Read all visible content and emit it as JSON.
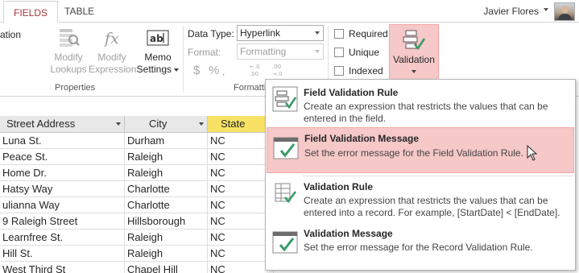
{
  "tabs": {
    "fields": "FIELDS",
    "table": "TABLE"
  },
  "user": {
    "name": "Javier Flores"
  },
  "ribbon": {
    "partial_label": "ation",
    "modify_lookups": [
      "Modify",
      "Lookups"
    ],
    "modify_expression": [
      "Modify",
      "Expression"
    ],
    "memo_settings": [
      "Memo",
      "Settings"
    ],
    "properties_group": "Properties",
    "data_type_label": "Data Type:",
    "data_type_value": "Hyperlink",
    "format_label": "Format:",
    "format_value": "Formatting",
    "currency_symbol": "$",
    "percent_symbol": "%",
    "formatting_group": "Formatti",
    "required": "Required",
    "unique": "Unique",
    "indexed": "Indexed",
    "validation": "Validation"
  },
  "columns": [
    "Street Address",
    "City",
    "State"
  ],
  "rows": [
    {
      "street": "Luna St.",
      "city": "Durham",
      "state": "NC"
    },
    {
      "street": "Peace St.",
      "city": "Raleigh",
      "state": "NC"
    },
    {
      "street": "Home Dr.",
      "city": "Raleigh",
      "state": "NC"
    },
    {
      "street": "Hatsy Way",
      "city": "Charlotte",
      "state": "NC"
    },
    {
      "street": "ulianna Way",
      "city": "Charlotte",
      "state": "NC"
    },
    {
      "street": "9 Raleigh Street",
      "city": "Hillsborough",
      "state": "NC"
    },
    {
      "street": "Learnfree St.",
      "city": "Raleigh",
      "state": "NC"
    },
    {
      "street": "Hill St.",
      "city": "Raleigh",
      "state": "NC"
    },
    {
      "street": "West Third St",
      "city": "Chapel Hill",
      "state": "NC"
    }
  ],
  "menu": [
    {
      "title": "Field Validation Rule",
      "desc": "Create an expression that restricts the values that can be entered in the field.",
      "icon": "field-validation-rule-icon"
    },
    {
      "title": "Field Validation Message",
      "desc": "Set the error message for the Field Validation Rule.",
      "icon": "field-validation-message-icon"
    },
    {
      "title": "Validation Rule",
      "desc": "Create an expression that restricts the values that can be entered into a record.  For example, [StartDate] < [EndDate].",
      "icon": "validation-rule-icon"
    },
    {
      "title": "Validation Message",
      "desc": "Set the error message for the Record Validation Rule.",
      "icon": "validation-message-icon"
    }
  ],
  "colors": {
    "accent": "#a4373a",
    "highlight": "#f6c8c8",
    "state_header": "#f8e266",
    "check_green": "#3a9b67"
  }
}
